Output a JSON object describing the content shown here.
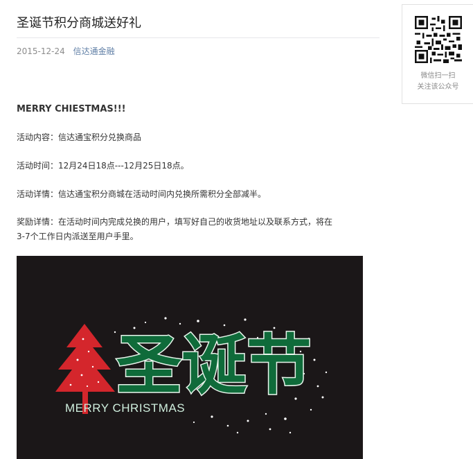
{
  "article": {
    "title": "圣诞节积分商城送好礼",
    "date": "2015-12-24",
    "account": "信达通金融",
    "heading": "MERRY CHIESTMAS!!!",
    "paragraphs": [
      "活动内容：信达通宝积分兑换商品",
      "活动时间：12月24日18点---12月25日18点。",
      "活动详情：信达通宝积分商城在活动时间内兑换所需积分全部减半。",
      "奖励详情：在活动时间内完成兑换的用户，填写好自己的收货地址以及联系方式，将在3-7个工作日内派送至用户手里。"
    ],
    "banner": {
      "headline": "圣诞节",
      "subtitle": "MERRY CHRISTMAS"
    }
  },
  "qr_panel": {
    "caption_line1": "微信扫一扫",
    "caption_line2": "关注该公众号"
  },
  "colors": {
    "link": "#607fa6",
    "banner_bg": "#1b1718",
    "tree_red": "#d4262c",
    "headline_green": "#0f6b3a"
  }
}
